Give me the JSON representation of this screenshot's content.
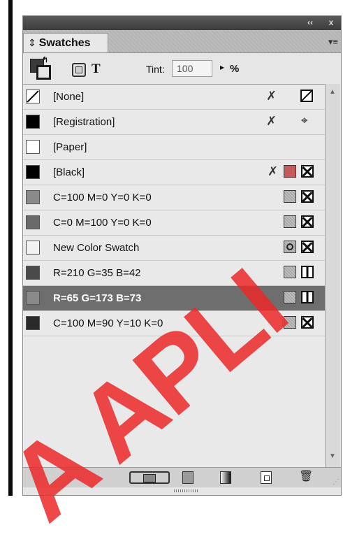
{
  "titlebar": {
    "collapse_icon": "double-chevron-left-icon",
    "collapse_glyph": "‹‹",
    "close_glyph": "x"
  },
  "tab": {
    "arrows_glyph": "⇕",
    "label": "Swatches"
  },
  "panel_menu": {
    "glyph": "▾≡"
  },
  "controls": {
    "text_button_label": "T",
    "tint_label": "Tint:",
    "tint_value": "100",
    "tint_arrow": "▸",
    "tint_unit": "%"
  },
  "swatches": [
    {
      "name": "[None]",
      "chip_color": "none"
    },
    {
      "name": "[Registration]",
      "chip_color": "#000000"
    },
    {
      "name": "[Paper]",
      "chip_color": "#ffffff"
    },
    {
      "name": "[Black]",
      "chip_color": "#000000"
    },
    {
      "name": "C=100 M=0 Y=0 K=0",
      "chip_color": "#8a8a8a"
    },
    {
      "name": "C=0 M=100 Y=0 K=0",
      "chip_color": "#6a6a6a"
    },
    {
      "name": "New Color Swatch",
      "chip_color": "#f2f2f2"
    },
    {
      "name": "R=210 G=35 B=42",
      "chip_color": "#4a4a4a"
    },
    {
      "name": "R=65 G=173 B=73",
      "chip_color": "#8a8a8a"
    },
    {
      "name": "C=100 M=90 Y=10 K=0",
      "chip_color": "#2a2a2a"
    }
  ],
  "selected_swatch": "R=65 G=173 B=73",
  "icons": {
    "pencil_glyph": "✗",
    "target_glyph": "⌖",
    "trash_glyph": "🗑"
  },
  "watermark": "A APLI"
}
